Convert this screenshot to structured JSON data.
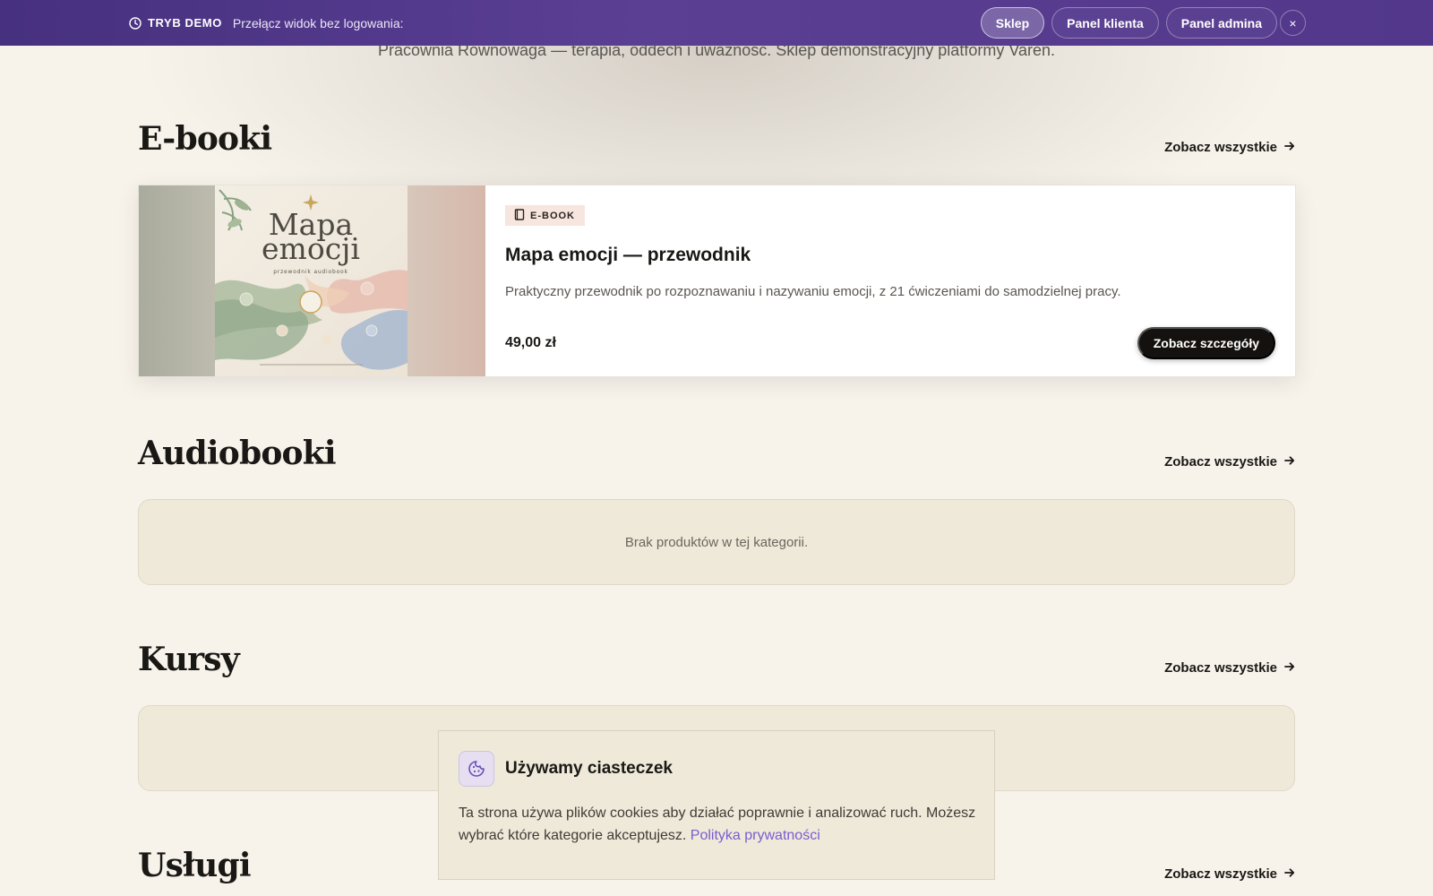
{
  "demo_bar": {
    "tag": "TRYB DEMO",
    "text": "Przełącz widok bez logowania:",
    "buttons": [
      "Sklep",
      "Panel klienta",
      "Panel admina"
    ],
    "active": "Sklep",
    "close_label": "×"
  },
  "tagline": "Pracownia Równowaga — terapia, oddech i uważność. Sklep demonstracyjny platformy Varen.",
  "see_all_label": "Zobacz wszystkie",
  "sections": {
    "ebooks": {
      "title": "E-booki",
      "product": {
        "badge": "E-BOOK",
        "cover_title_line1": "Mapa",
        "cover_title_line2": "emocji",
        "cover_subtitle": "przewodnik audiobook",
        "title": "Mapa emocji — przewodnik",
        "description": "Praktyczny przewodnik po rozpoznawaniu i nazywaniu emocji, z 21 ćwiczeniami do samodzielnej pracy.",
        "price": "49,00 zł",
        "cta": "Zobacz szczegóły"
      }
    },
    "audiobooks": {
      "title": "Audiobooki",
      "empty": "Brak produktów w tej kategorii."
    },
    "courses": {
      "title": "Kursy"
    },
    "services": {
      "title": "Usługi"
    }
  },
  "cookie": {
    "title": "Używamy ciasteczek",
    "text": "Ta strona używa plików cookies aby działać poprawnie i analizować ruch. Możesz wybrać które kategorie akceptujesz.",
    "link": "Polityka prywatności"
  },
  "colors": {
    "accent": "#5b3f93",
    "background": "#f7f3eb",
    "link": "#7b5cd0",
    "button_dark": "#14110e"
  }
}
